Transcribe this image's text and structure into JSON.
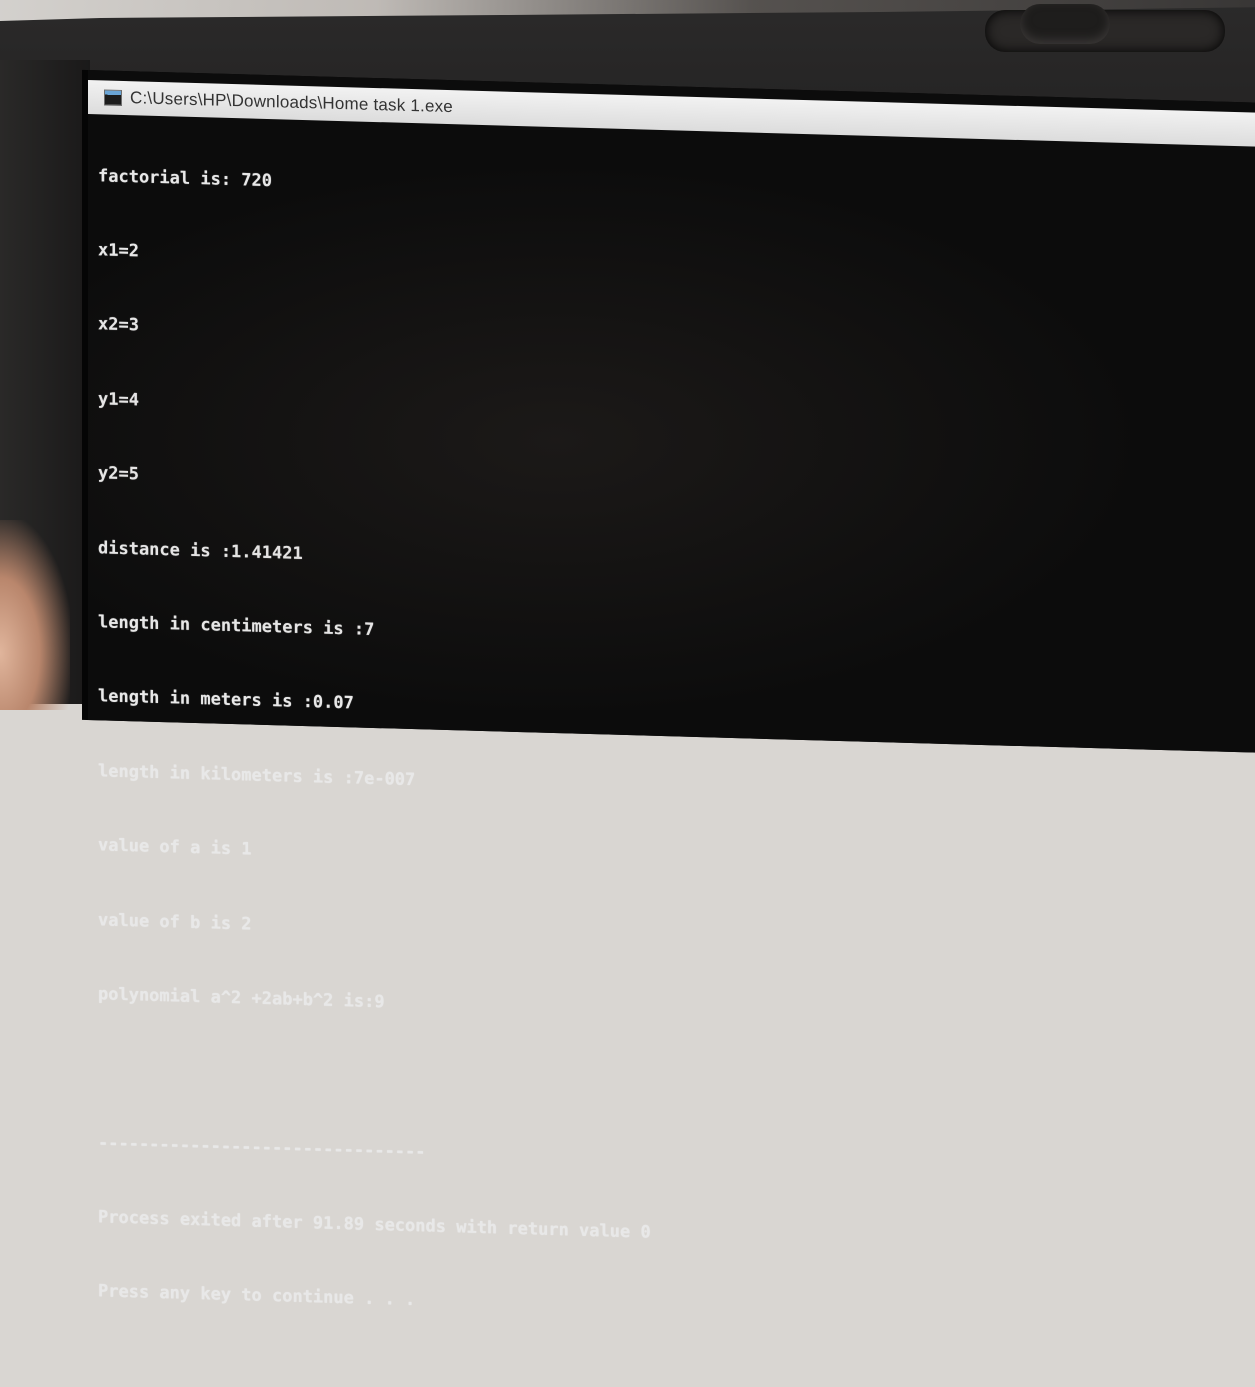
{
  "window": {
    "title": "C:\\Users\\HP\\Downloads\\Home task 1.exe",
    "icon": "console-app-icon"
  },
  "console": {
    "lines": [
      "factorial is: 720",
      "x1=2",
      "x2=3",
      "y1=4",
      "y2=5",
      "distance is :1.41421",
      "length in centimeters is :7",
      "length in meters is :0.07",
      "length in kilometers is :7e-007",
      "value of a is 1",
      "value of b is 2",
      "polynomial a^2 +2ab+b^2 is:9",
      "",
      "--------------------------------",
      "Process exited after 91.89 seconds with return value 0",
      "Press any key to continue . . ."
    ]
  }
}
